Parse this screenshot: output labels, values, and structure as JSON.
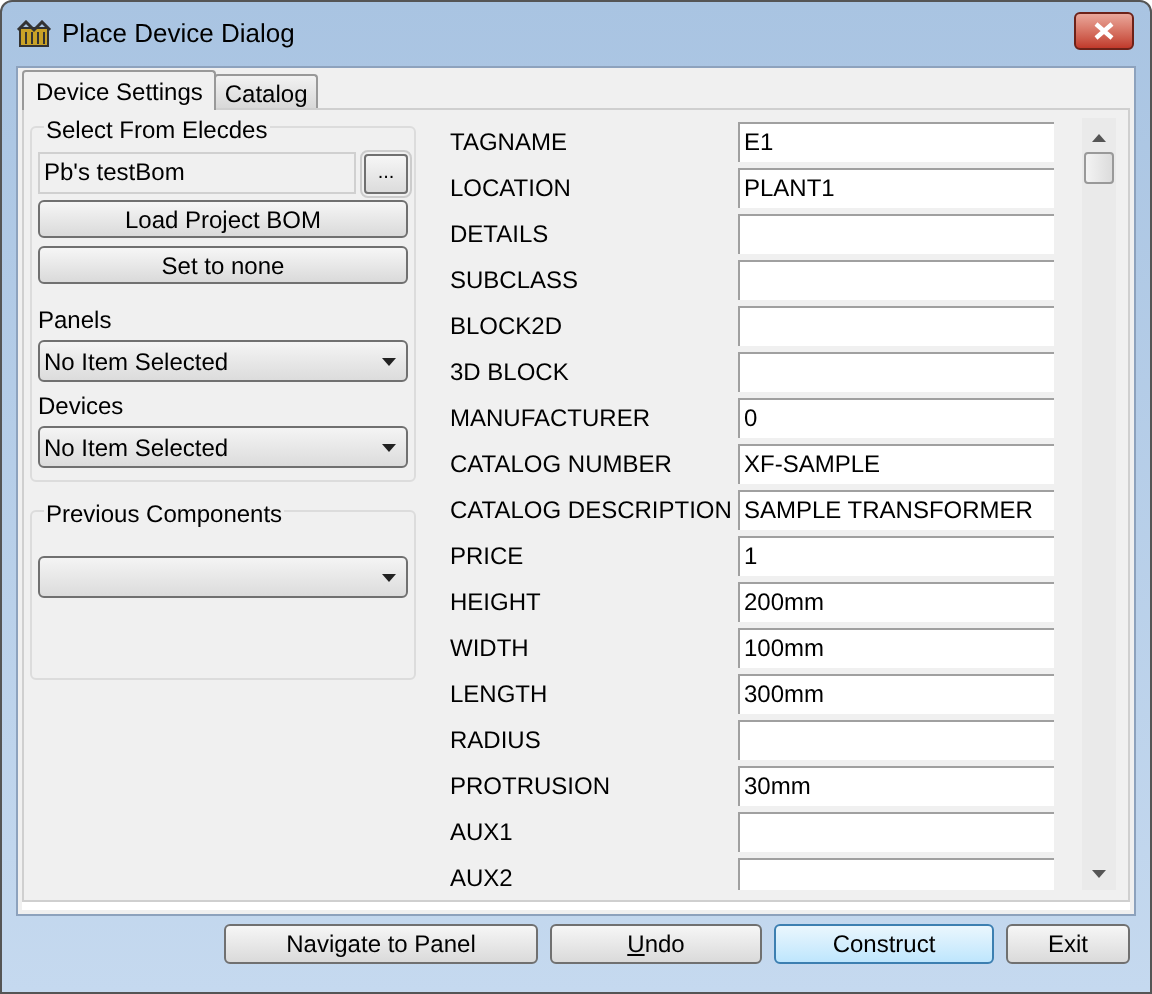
{
  "window": {
    "title": "Place Device Dialog"
  },
  "tabs": [
    {
      "label": "Device Settings",
      "selected": true
    },
    {
      "label": "Catalog",
      "selected": false
    }
  ],
  "elecdes_group": {
    "title": "Select From Elecdes",
    "bom_value": "Pb's testBom",
    "browse_button": "...",
    "load_button": "Load Project BOM",
    "none_button": "Set to none"
  },
  "panels": {
    "label": "Panels",
    "value": "No Item Selected"
  },
  "devices": {
    "label": "Devices",
    "value": "No Item Selected"
  },
  "previous_group": {
    "title": "Previous Components"
  },
  "properties": [
    {
      "name": "TAGNAME",
      "value": "E1"
    },
    {
      "name": "LOCATION",
      "value": "PLANT1"
    },
    {
      "name": "DETAILS"
    },
    {
      "name": "SUBCLASS"
    },
    {
      "name": "BLOCK2D"
    },
    {
      "name": "3D BLOCK"
    },
    {
      "name": "MANUFACTURER",
      "value": "0"
    },
    {
      "name": "CATALOG NUMBER",
      "value": "XF-SAMPLE"
    },
    {
      "name": "CATALOG DESCRIPTION",
      "value": "SAMPLE TRANSFORMER"
    },
    {
      "name": "PRICE",
      "value": "1"
    },
    {
      "name": "HEIGHT",
      "value": "200mm"
    },
    {
      "name": "WIDTH",
      "value": "100mm"
    },
    {
      "name": "LENGTH",
      "value": "300mm"
    },
    {
      "name": "RADIUS"
    },
    {
      "name": "PROTRUSION",
      "value": "30mm"
    },
    {
      "name": "AUX1"
    },
    {
      "name": "AUX2"
    }
  ],
  "buttons": [
    {
      "label": "Navigate to Panel",
      "default": false,
      "mnemonic": false
    },
    {
      "label": "Undo",
      "default": false,
      "mnemonic": true
    },
    {
      "label": "Construct",
      "default": true,
      "mnemonic": false
    },
    {
      "label": "Exit",
      "default": false,
      "mnemonic": false
    }
  ]
}
